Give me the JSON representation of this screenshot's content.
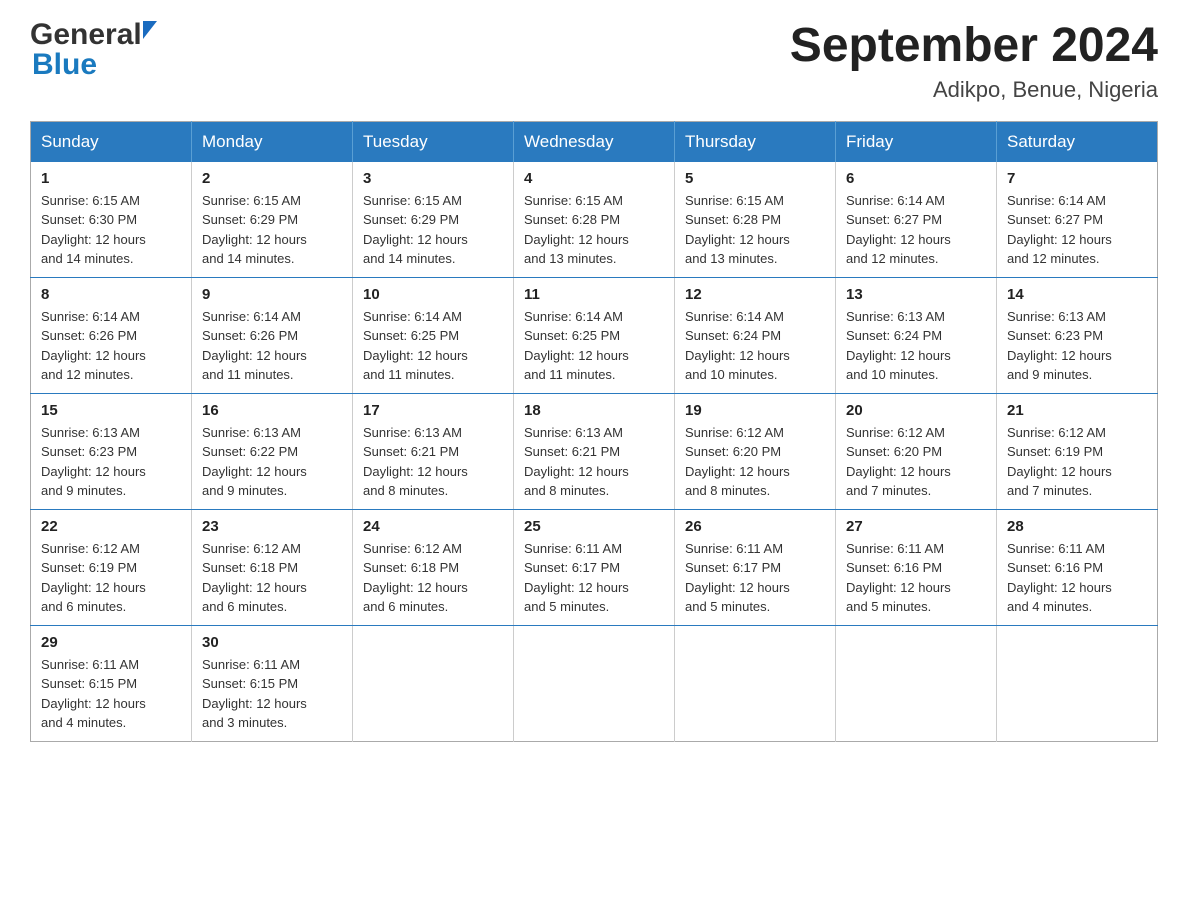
{
  "header": {
    "logo_general": "General",
    "logo_blue": "Blue",
    "month_year": "September 2024",
    "location": "Adikpo, Benue, Nigeria"
  },
  "days_of_week": [
    "Sunday",
    "Monday",
    "Tuesday",
    "Wednesday",
    "Thursday",
    "Friday",
    "Saturday"
  ],
  "weeks": [
    [
      {
        "day": "1",
        "sunrise": "6:15 AM",
        "sunset": "6:30 PM",
        "daylight": "12 hours and 14 minutes."
      },
      {
        "day": "2",
        "sunrise": "6:15 AM",
        "sunset": "6:29 PM",
        "daylight": "12 hours and 14 minutes."
      },
      {
        "day": "3",
        "sunrise": "6:15 AM",
        "sunset": "6:29 PM",
        "daylight": "12 hours and 14 minutes."
      },
      {
        "day": "4",
        "sunrise": "6:15 AM",
        "sunset": "6:28 PM",
        "daylight": "12 hours and 13 minutes."
      },
      {
        "day": "5",
        "sunrise": "6:15 AM",
        "sunset": "6:28 PM",
        "daylight": "12 hours and 13 minutes."
      },
      {
        "day": "6",
        "sunrise": "6:14 AM",
        "sunset": "6:27 PM",
        "daylight": "12 hours and 12 minutes."
      },
      {
        "day": "7",
        "sunrise": "6:14 AM",
        "sunset": "6:27 PM",
        "daylight": "12 hours and 12 minutes."
      }
    ],
    [
      {
        "day": "8",
        "sunrise": "6:14 AM",
        "sunset": "6:26 PM",
        "daylight": "12 hours and 12 minutes."
      },
      {
        "day": "9",
        "sunrise": "6:14 AM",
        "sunset": "6:26 PM",
        "daylight": "12 hours and 11 minutes."
      },
      {
        "day": "10",
        "sunrise": "6:14 AM",
        "sunset": "6:25 PM",
        "daylight": "12 hours and 11 minutes."
      },
      {
        "day": "11",
        "sunrise": "6:14 AM",
        "sunset": "6:25 PM",
        "daylight": "12 hours and 11 minutes."
      },
      {
        "day": "12",
        "sunrise": "6:14 AM",
        "sunset": "6:24 PM",
        "daylight": "12 hours and 10 minutes."
      },
      {
        "day": "13",
        "sunrise": "6:13 AM",
        "sunset": "6:24 PM",
        "daylight": "12 hours and 10 minutes."
      },
      {
        "day": "14",
        "sunrise": "6:13 AM",
        "sunset": "6:23 PM",
        "daylight": "12 hours and 9 minutes."
      }
    ],
    [
      {
        "day": "15",
        "sunrise": "6:13 AM",
        "sunset": "6:23 PM",
        "daylight": "12 hours and 9 minutes."
      },
      {
        "day": "16",
        "sunrise": "6:13 AM",
        "sunset": "6:22 PM",
        "daylight": "12 hours and 9 minutes."
      },
      {
        "day": "17",
        "sunrise": "6:13 AM",
        "sunset": "6:21 PM",
        "daylight": "12 hours and 8 minutes."
      },
      {
        "day": "18",
        "sunrise": "6:13 AM",
        "sunset": "6:21 PM",
        "daylight": "12 hours and 8 minutes."
      },
      {
        "day": "19",
        "sunrise": "6:12 AM",
        "sunset": "6:20 PM",
        "daylight": "12 hours and 8 minutes."
      },
      {
        "day": "20",
        "sunrise": "6:12 AM",
        "sunset": "6:20 PM",
        "daylight": "12 hours and 7 minutes."
      },
      {
        "day": "21",
        "sunrise": "6:12 AM",
        "sunset": "6:19 PM",
        "daylight": "12 hours and 7 minutes."
      }
    ],
    [
      {
        "day": "22",
        "sunrise": "6:12 AM",
        "sunset": "6:19 PM",
        "daylight": "12 hours and 6 minutes."
      },
      {
        "day": "23",
        "sunrise": "6:12 AM",
        "sunset": "6:18 PM",
        "daylight": "12 hours and 6 minutes."
      },
      {
        "day": "24",
        "sunrise": "6:12 AM",
        "sunset": "6:18 PM",
        "daylight": "12 hours and 6 minutes."
      },
      {
        "day": "25",
        "sunrise": "6:11 AM",
        "sunset": "6:17 PM",
        "daylight": "12 hours and 5 minutes."
      },
      {
        "day": "26",
        "sunrise": "6:11 AM",
        "sunset": "6:17 PM",
        "daylight": "12 hours and 5 minutes."
      },
      {
        "day": "27",
        "sunrise": "6:11 AM",
        "sunset": "6:16 PM",
        "daylight": "12 hours and 5 minutes."
      },
      {
        "day": "28",
        "sunrise": "6:11 AM",
        "sunset": "6:16 PM",
        "daylight": "12 hours and 4 minutes."
      }
    ],
    [
      {
        "day": "29",
        "sunrise": "6:11 AM",
        "sunset": "6:15 PM",
        "daylight": "12 hours and 4 minutes."
      },
      {
        "day": "30",
        "sunrise": "6:11 AM",
        "sunset": "6:15 PM",
        "daylight": "12 hours and 3 minutes."
      },
      null,
      null,
      null,
      null,
      null
    ]
  ],
  "labels": {
    "sunrise": "Sunrise:",
    "sunset": "Sunset:",
    "daylight": "Daylight:"
  }
}
